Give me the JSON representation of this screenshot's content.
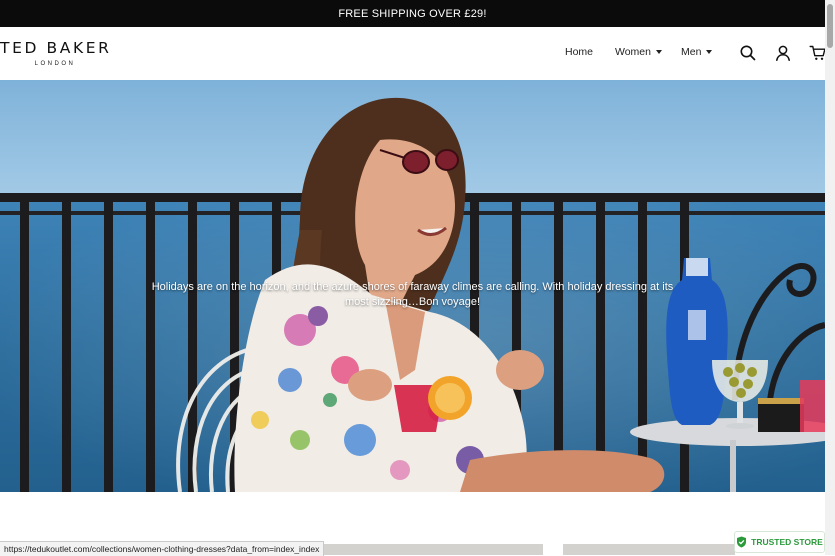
{
  "announcement": {
    "text": "FREE SHIPPING OVER £29!"
  },
  "header": {
    "logo": {
      "main": "TED BAKER",
      "sub": "LONDON"
    },
    "nav": [
      {
        "label": "Home"
      },
      {
        "label": "Women"
      },
      {
        "label": "Men"
      }
    ],
    "icons": [
      "search-icon",
      "account-icon",
      "cart-icon"
    ]
  },
  "hero": {
    "caption": "Holidays are on the horizon, and the azure shores of faraway climes are calling. With holiday dressing at its most sizzling…Bon voyage!"
  },
  "status_bar": {
    "url": "https://tedukoutlet.com/collections/women-clothing-dresses?data_from=index_index"
  },
  "trust_badge": {
    "label": "TRUSTED STORE"
  },
  "colors": {
    "announcement_bg": "#0b0b0b",
    "trust_green": "#2b9a3b",
    "sea_blue": "#2c6e9e"
  }
}
